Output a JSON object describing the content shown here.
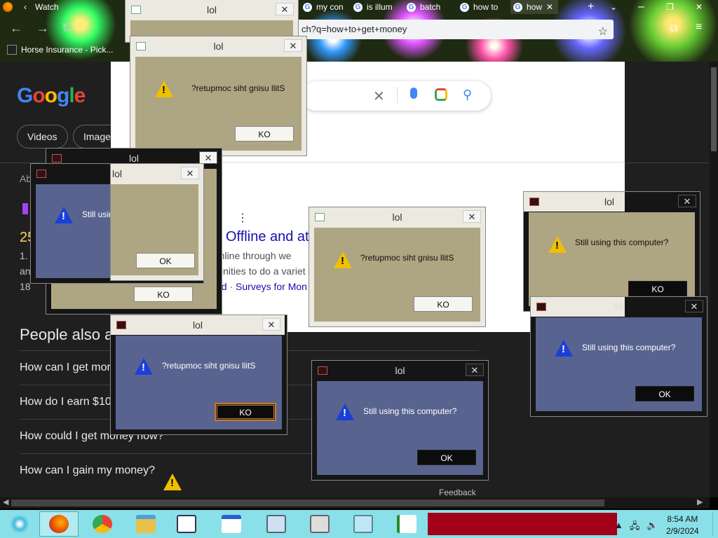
{
  "browser": {
    "tabs": [
      {
        "label": "Watch"
      },
      {
        "label": "my con"
      },
      {
        "label": "is illum"
      },
      {
        "label": "batch"
      },
      {
        "label": "how to"
      },
      {
        "label": "how"
      }
    ],
    "new_tab": "+",
    "address": "ch?q=how+to+get+money",
    "bookmark": "Horse Insurance - Pick..."
  },
  "google": {
    "logo": "Google",
    "chips": [
      "Videos",
      "Images"
    ],
    "about_fragment": "Ab",
    "result_title": "Offline and at",
    "result_num": "25",
    "result_snip_num1": "1.",
    "result_snip_num2": "an",
    "result_snip_num3": "18",
    "result_snip1": "y online through we",
    "result_snip2": "ortunities to do a variet",
    "result_link1": "a kid",
    "result_link2": "Surveys for Mon",
    "result_dot": "·",
    "paa_title": "People also a",
    "questions": [
      "How can I get mor",
      "How do I earn $10",
      "How could I get money now?",
      "How can I gain my money?"
    ],
    "feedback": "Feedback"
  },
  "dialogs": {
    "title": "lol",
    "msg_reversed": "?retupmoc siht gnisu llitS",
    "msg_normal": "Still using this computer?",
    "ok": "OK",
    "ko": "KO",
    "close": "✕"
  },
  "taskbar": {
    "time": "8:54 AM",
    "date": "2/9/2024"
  }
}
